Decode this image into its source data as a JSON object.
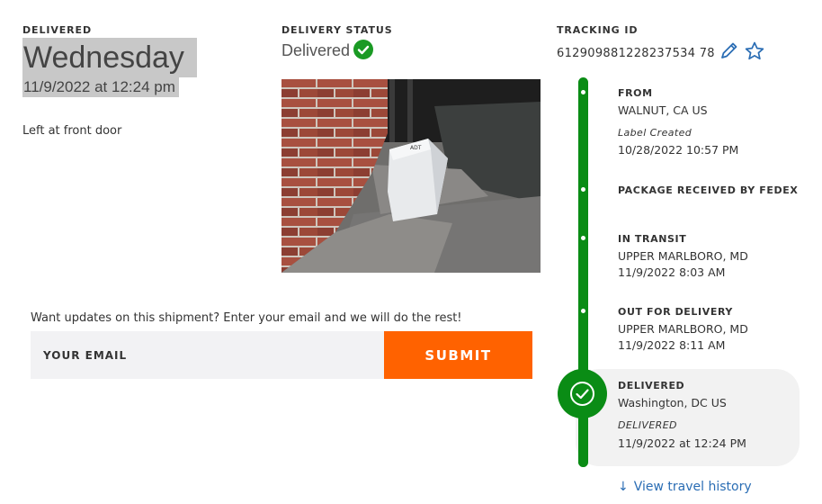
{
  "delivered": {
    "label": "DELIVERED",
    "day": "Wednesday",
    "datetime": "11/9/2022 at 12:24 pm",
    "note": "Left at front door"
  },
  "status": {
    "label": "DELIVERY STATUS",
    "value": "Delivered",
    "icon": "check-circle-icon",
    "color": "#1a9a24"
  },
  "tracking": {
    "label": "TRACKING ID",
    "id": "612909881228237534 78",
    "edit_icon": "pencil-icon",
    "watch_icon": "star-icon"
  },
  "signup": {
    "text": "Want updates on this shipment? Enter your email and we will do the rest!",
    "email_placeholder": "YOUR EMAIL",
    "submit_label": "SUBMIT",
    "submit_color": "#ff6200"
  },
  "timeline": {
    "color": "#0a8c15",
    "events": [
      {
        "title": "FROM",
        "line1": "WALNUT, CA US",
        "sub": "Label Created",
        "line2": "10/28/2022 10:57 PM"
      },
      {
        "title": "PACKAGE RECEIVED BY FEDEX"
      },
      {
        "title": "IN TRANSIT",
        "line1": "UPPER MARLBORO, MD",
        "line2": "11/9/2022 8:03 AM"
      },
      {
        "title": "OUT FOR DELIVERY",
        "line1": "UPPER MARLBORO, MD",
        "line2": "11/9/2022 8:11 AM"
      },
      {
        "title": "DELIVERED",
        "line1": "Washington, DC US",
        "sub": "DELIVERED",
        "line2": "11/9/2022 at 12:24 PM"
      }
    ],
    "history_link": "View travel history"
  }
}
